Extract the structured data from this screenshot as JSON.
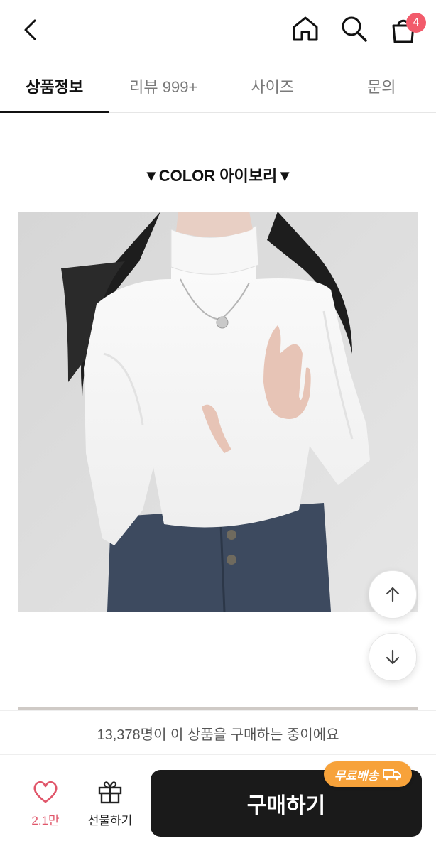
{
  "header": {
    "back_icon": "chevron-left-icon",
    "home_icon": "home-icon",
    "search_icon": "search-icon",
    "cart_icon": "shopping-bag-icon",
    "cart_count": "4"
  },
  "tabs": [
    {
      "label": "상품정보",
      "active": true
    },
    {
      "label": "리뷰 999+",
      "active": false
    },
    {
      "label": "사이즈",
      "active": false
    },
    {
      "label": "문의",
      "active": false
    }
  ],
  "content": {
    "color_heading": "▼COLOR 아이보리▼"
  },
  "scroll": {
    "up_icon": "arrow-up-icon",
    "down_icon": "arrow-down-icon"
  },
  "notice": {
    "text": "13,378명이 이 상품을 구매하는 중이에요"
  },
  "bottom_bar": {
    "like_count": "2.1만",
    "gift_label": "선물하기",
    "buy_label": "구매하기",
    "free_shipping_badge": "무료배송",
    "accent_color": "#f25b6b",
    "badge_color": "#f7a23a"
  }
}
